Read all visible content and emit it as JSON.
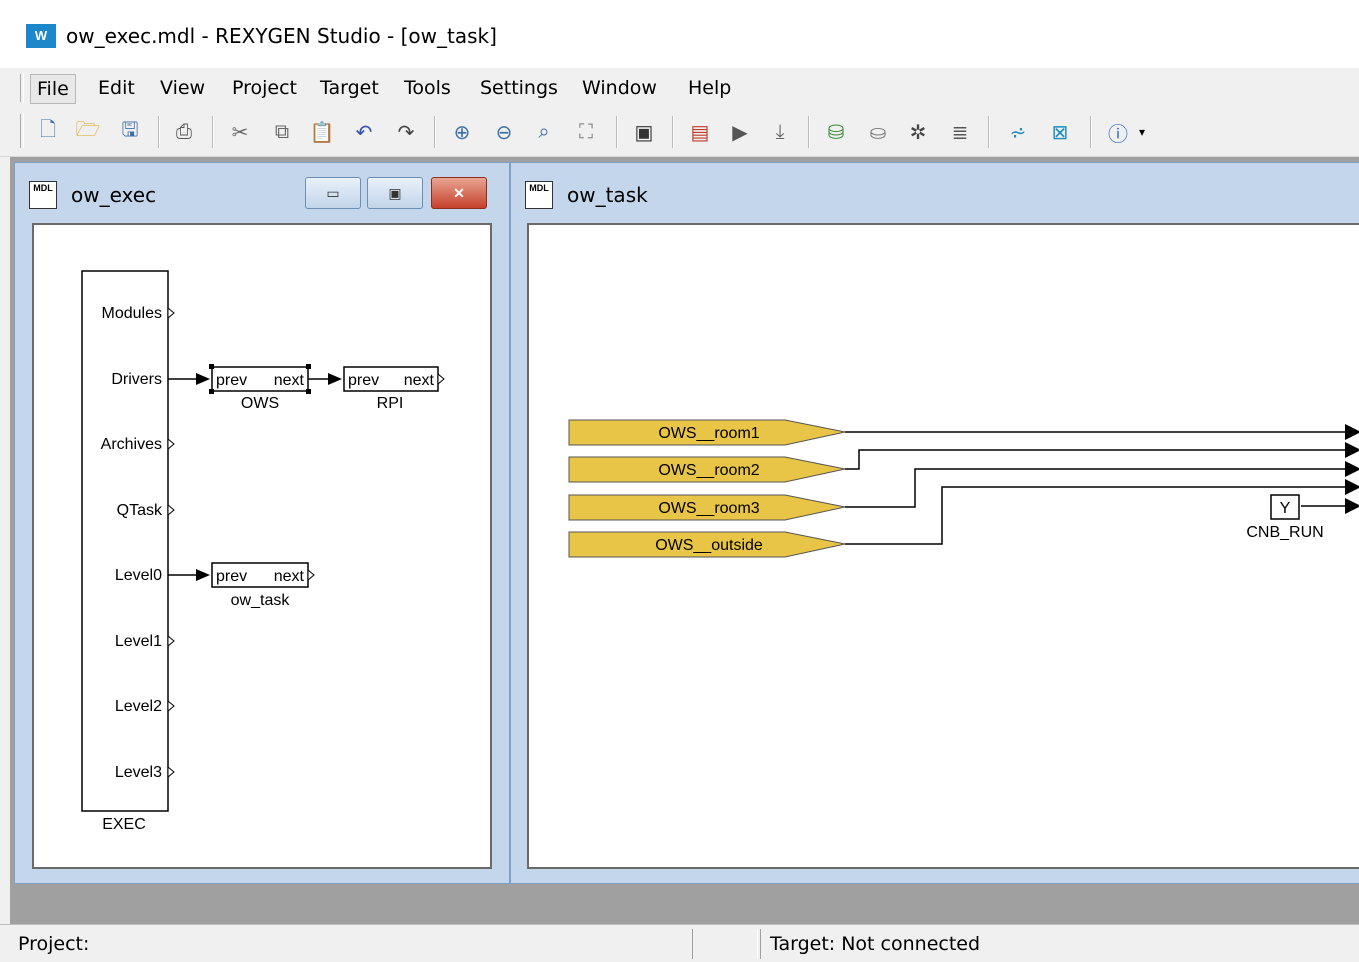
{
  "window": {
    "title": "ow_exec.mdl - REXYGEN Studio - [ow_task]"
  },
  "menu": [
    "File",
    "Edit",
    "View",
    "Project",
    "Target",
    "Tools",
    "Settings",
    "Window",
    "Help"
  ],
  "toolbar_icons": [
    "new-file-icon",
    "open-folder-icon",
    "save-icon",
    "print-icon",
    "cut-icon",
    "copy-icon",
    "paste-icon",
    "undo-icon",
    "redo-icon",
    "zoom-in-icon",
    "zoom-out-icon",
    "zoom-fit-icon",
    "zoom-grid-icon",
    "block-library-icon",
    "compile-icon",
    "compile-download-icon",
    "download-icon",
    "connect-icon",
    "disconnect-icon",
    "settings-icon",
    "list-icon",
    "diagnostics-icon",
    "watch-icon",
    "info-icon"
  ],
  "exec_window": {
    "title": "ow_exec",
    "exec_block": {
      "label": "EXEC",
      "ports": [
        "Modules",
        "Drivers",
        "Archives",
        "QTask",
        "Level0",
        "Level1",
        "Level2",
        "Level3"
      ]
    },
    "blocks": [
      {
        "name": "OWS",
        "in": "prev",
        "out": "next"
      },
      {
        "name": "RPI",
        "in": "prev",
        "out": "next"
      },
      {
        "name": "ow_task",
        "in": "prev",
        "out": "next"
      }
    ]
  },
  "task_window": {
    "title": "ow_task",
    "inputs": [
      "OWS__room1",
      "OWS__room2",
      "OWS__room3",
      "OWS__outside"
    ],
    "cnb_block": {
      "name": "CNB_RUN",
      "port": "Y"
    }
  },
  "statusbar": {
    "project": "Project:",
    "target": "Target: Not connected"
  },
  "colors": {
    "input_fill": "#e8c547",
    "window_frame": "#c3d6eb",
    "mdi_bg": "#a0a0a0"
  }
}
